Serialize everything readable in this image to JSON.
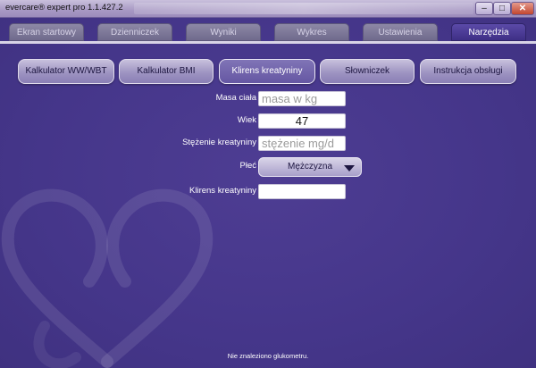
{
  "window": {
    "title": "evercare® expert pro 1.1.427.2",
    "minimize": "–",
    "maximize": "□",
    "close": "✕"
  },
  "tabs": [
    {
      "label": "Ekran startowy",
      "active": false
    },
    {
      "label": "Dzienniczek",
      "active": false
    },
    {
      "label": "Wyniki",
      "active": false
    },
    {
      "label": "Wykres",
      "active": false
    },
    {
      "label": "Ustawienia",
      "active": false
    },
    {
      "label": "Narzędzia",
      "active": true
    }
  ],
  "tools": [
    {
      "label": "Kalkulator WW/WBT",
      "active": false
    },
    {
      "label": "Kalkulator BMI",
      "active": false
    },
    {
      "label": "Klirens kreatyniny",
      "active": true
    },
    {
      "label": "Słowniczek",
      "active": false
    },
    {
      "label": "Instrukcja obsługi",
      "active": false
    }
  ],
  "form": {
    "weight_label": "Masa ciała",
    "weight_placeholder": "masa w kg",
    "age_label": "Wiek",
    "age_value": "47",
    "creatinine_label": "Stężenie kreatyniny",
    "creatinine_placeholder": "stężenie mg/d",
    "sex_label": "Płeć",
    "sex_value": "Mężczyzna",
    "clearance_label": "Klirens kreatyniny",
    "clearance_value": ""
  },
  "status": "Nie znaleziono glukometru.",
  "colors": {
    "background": "#45368a",
    "active_tab": "#3e2f85",
    "tab": "#7d7899",
    "tool_button": "#a79dc8"
  }
}
